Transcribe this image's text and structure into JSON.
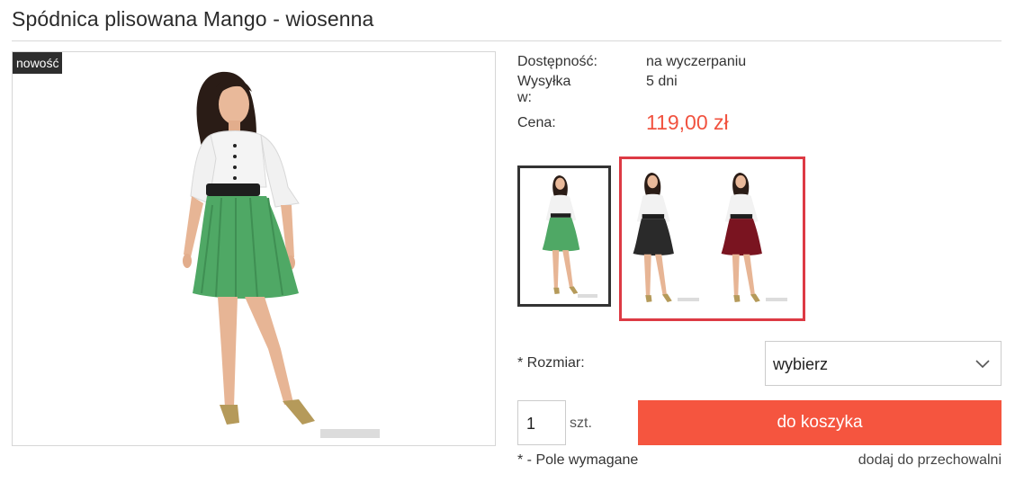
{
  "product": {
    "title": "Spódnica plisowana Mango - wiosenna",
    "badge": "nowość",
    "availability_label": "Dostępność:",
    "availability_value": "na wyczerpaniu",
    "shipping_label": "Wysyłka w:",
    "shipping_value": "5 dni",
    "price_label": "Cena:",
    "price_value": "119,00 zł",
    "price_color": "#f1523f"
  },
  "variants": [
    {
      "skirt_color": "#4fa865",
      "selected": true
    },
    {
      "skirt_color": "#2a2a2a",
      "selected": false
    },
    {
      "skirt_color": "#7a1420",
      "selected": false
    }
  ],
  "form": {
    "size_label": "* Rozmiar:",
    "size_selected": "wybierz",
    "quantity": "1",
    "quantity_unit": "szt.",
    "add_to_cart": "do koszyka",
    "required_note": "* - Pole wymagane",
    "add_to_storage": "dodaj do przechowalni",
    "accent_color": "#f5553f",
    "highlight_color": "#dd3a44"
  },
  "icons": {
    "select_arrow": "chevron-down-icon"
  }
}
